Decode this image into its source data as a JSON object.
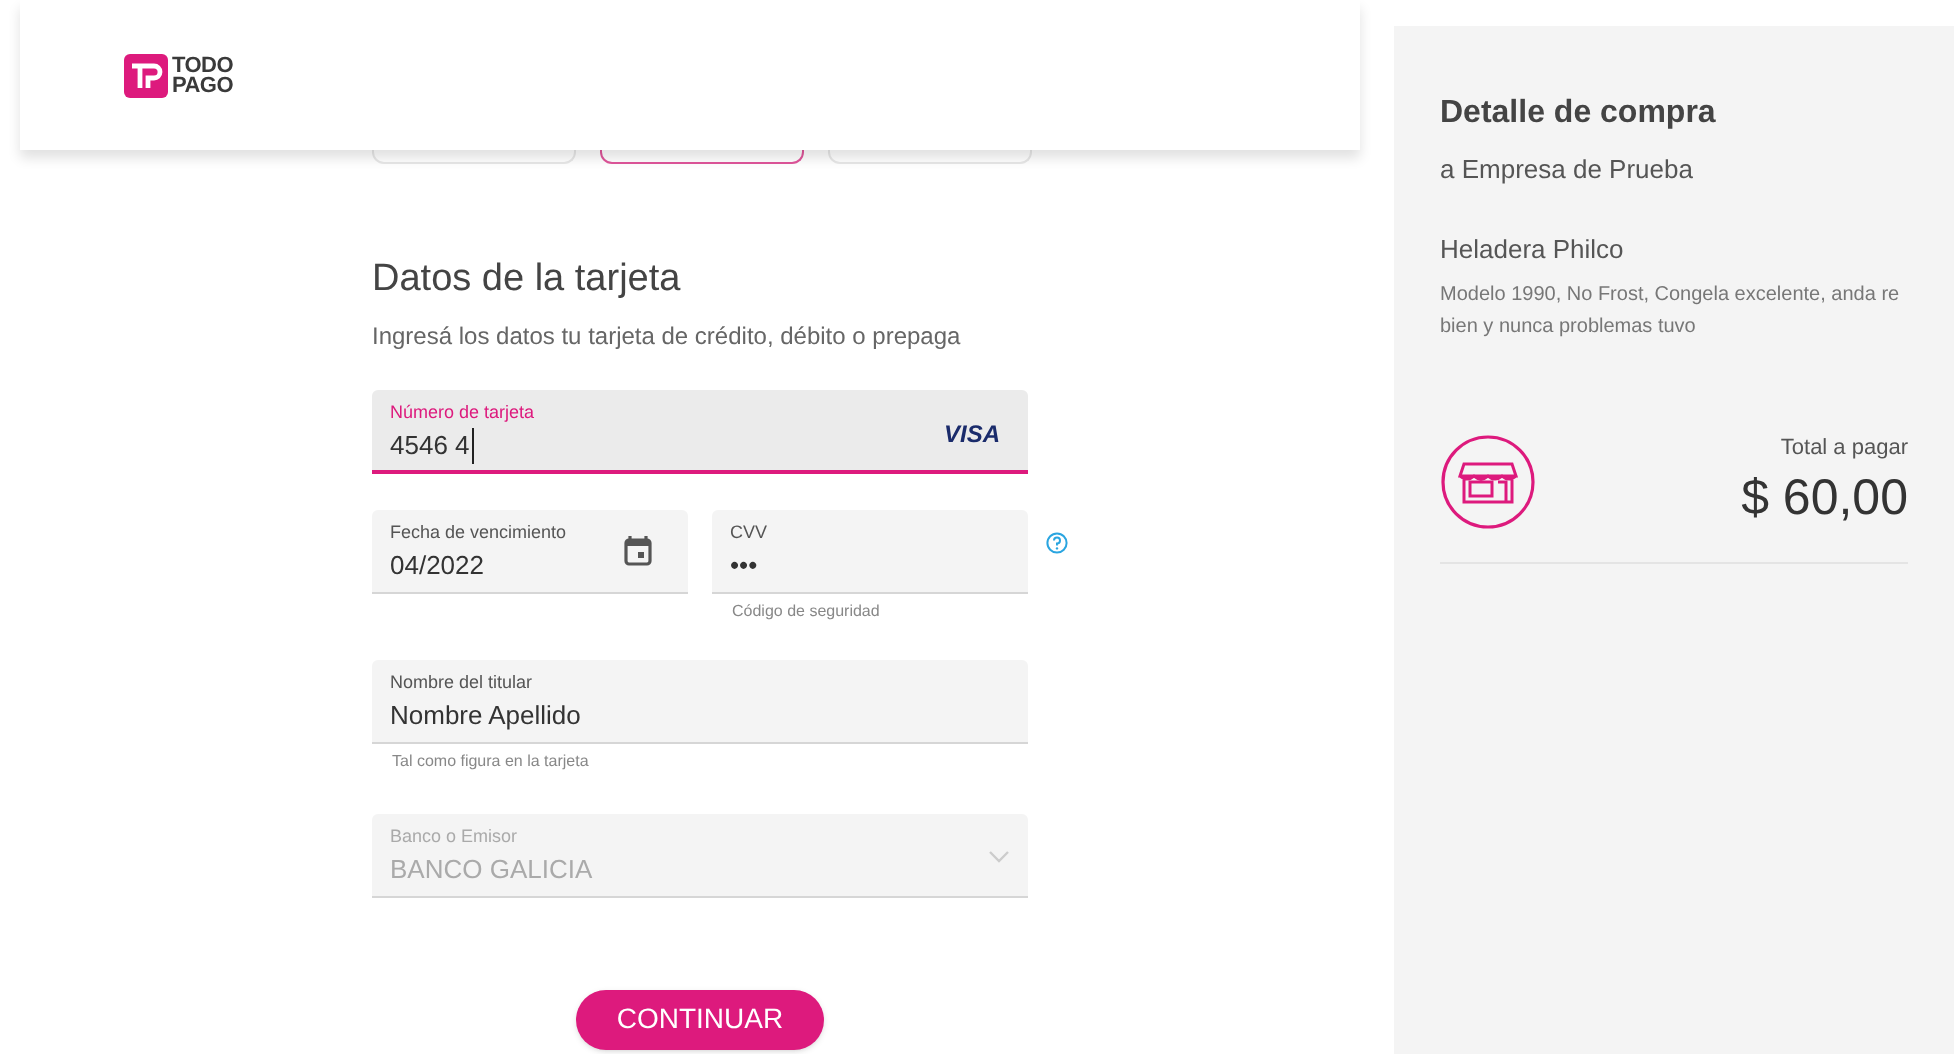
{
  "header": {
    "logo_lines": [
      "TODO",
      "PAGO"
    ]
  },
  "steps": [
    {
      "selected": false
    },
    {
      "selected": true
    },
    {
      "selected": false
    }
  ],
  "form": {
    "title": "Datos de la tarjeta",
    "subtitle": "Ingresá los datos tu tarjeta de crédito, débito o prepaga",
    "fields": [
      {
        "kind": "card",
        "label": "Número de tarjeta",
        "value": "4546 4",
        "focused": true,
        "disabled": false,
        "brand": "VISA"
      },
      {
        "kind": "date",
        "label": "Fecha de vencimiento",
        "value": "04/2022",
        "focused": false,
        "disabled": false
      },
      {
        "kind": "password",
        "label": "CVV",
        "value": "•••",
        "focused": false,
        "disabled": false,
        "helper": "Código de seguridad",
        "help": true
      },
      {
        "kind": "text",
        "label": "Nombre del titular",
        "value": "Nombre Apellido",
        "focused": false,
        "disabled": false,
        "helper": "Tal como figura en la tarjeta"
      },
      {
        "kind": "select",
        "label": "Banco o Emisor",
        "value": "BANCO GALICIA",
        "focused": false,
        "disabled": true
      }
    ],
    "submit": "CONTINUAR"
  },
  "summary": {
    "title": "Detalle de compra",
    "merchant": "a Empresa de Prueba",
    "product": "Heladera Philco",
    "description": "Modelo 1990, No Frost, Congela excelente, anda re bien y nunca problemas tuvo",
    "total_label": "Total a pagar",
    "total": "$ 60,00"
  }
}
